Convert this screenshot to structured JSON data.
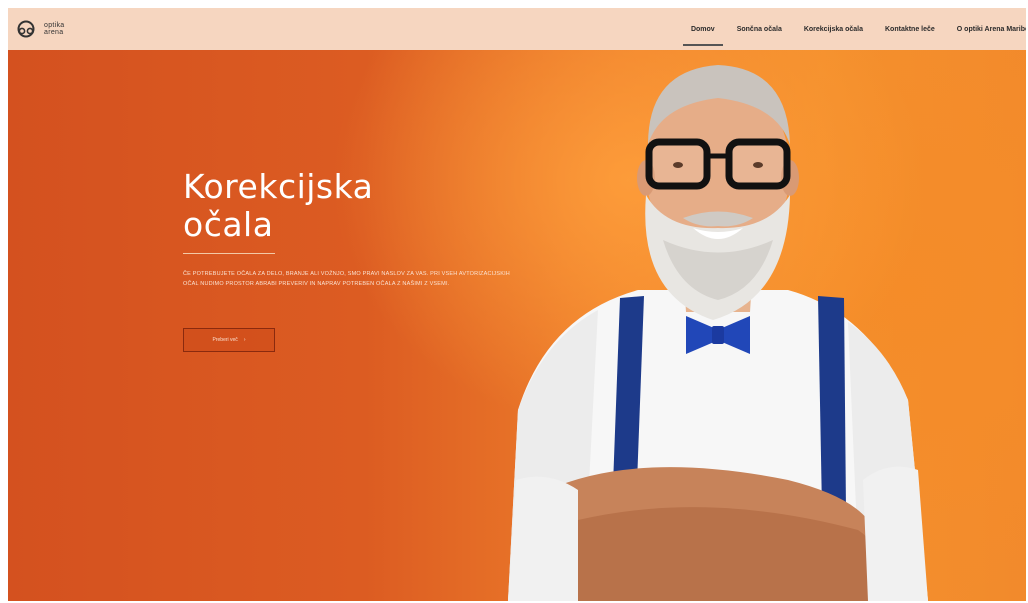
{
  "header": {
    "logo_line1": "optika",
    "logo_line2": "arena",
    "nav": [
      {
        "label": "Domov",
        "active": true
      },
      {
        "label": "Sončna očala",
        "active": false
      },
      {
        "label": "Korekcijska očala",
        "active": false
      },
      {
        "label": "Kontaktne leče",
        "active": false
      },
      {
        "label": "O optiki Arena Maribor",
        "active": false
      }
    ]
  },
  "hero": {
    "title_line1": "Korekcijska",
    "title_line2": "očala",
    "description": "Če potrebujete očala za delo, branje ali vožnjo, smo pravi naslov za vas. Pri vseh avtorizacijskih očal nudimo prostor abrabi preveriv in naprav potreben očala z našimi z vsemi.",
    "button_label": "Preberi več",
    "button_arrow": "›"
  },
  "colors": {
    "header_bg": "#f6d6c0",
    "hero_left": "#d4511f",
    "hero_right": "#f28a2c",
    "shirt": "#ffffff",
    "suspenders": "#1d3a8a",
    "bowtie": "#2147b8"
  }
}
